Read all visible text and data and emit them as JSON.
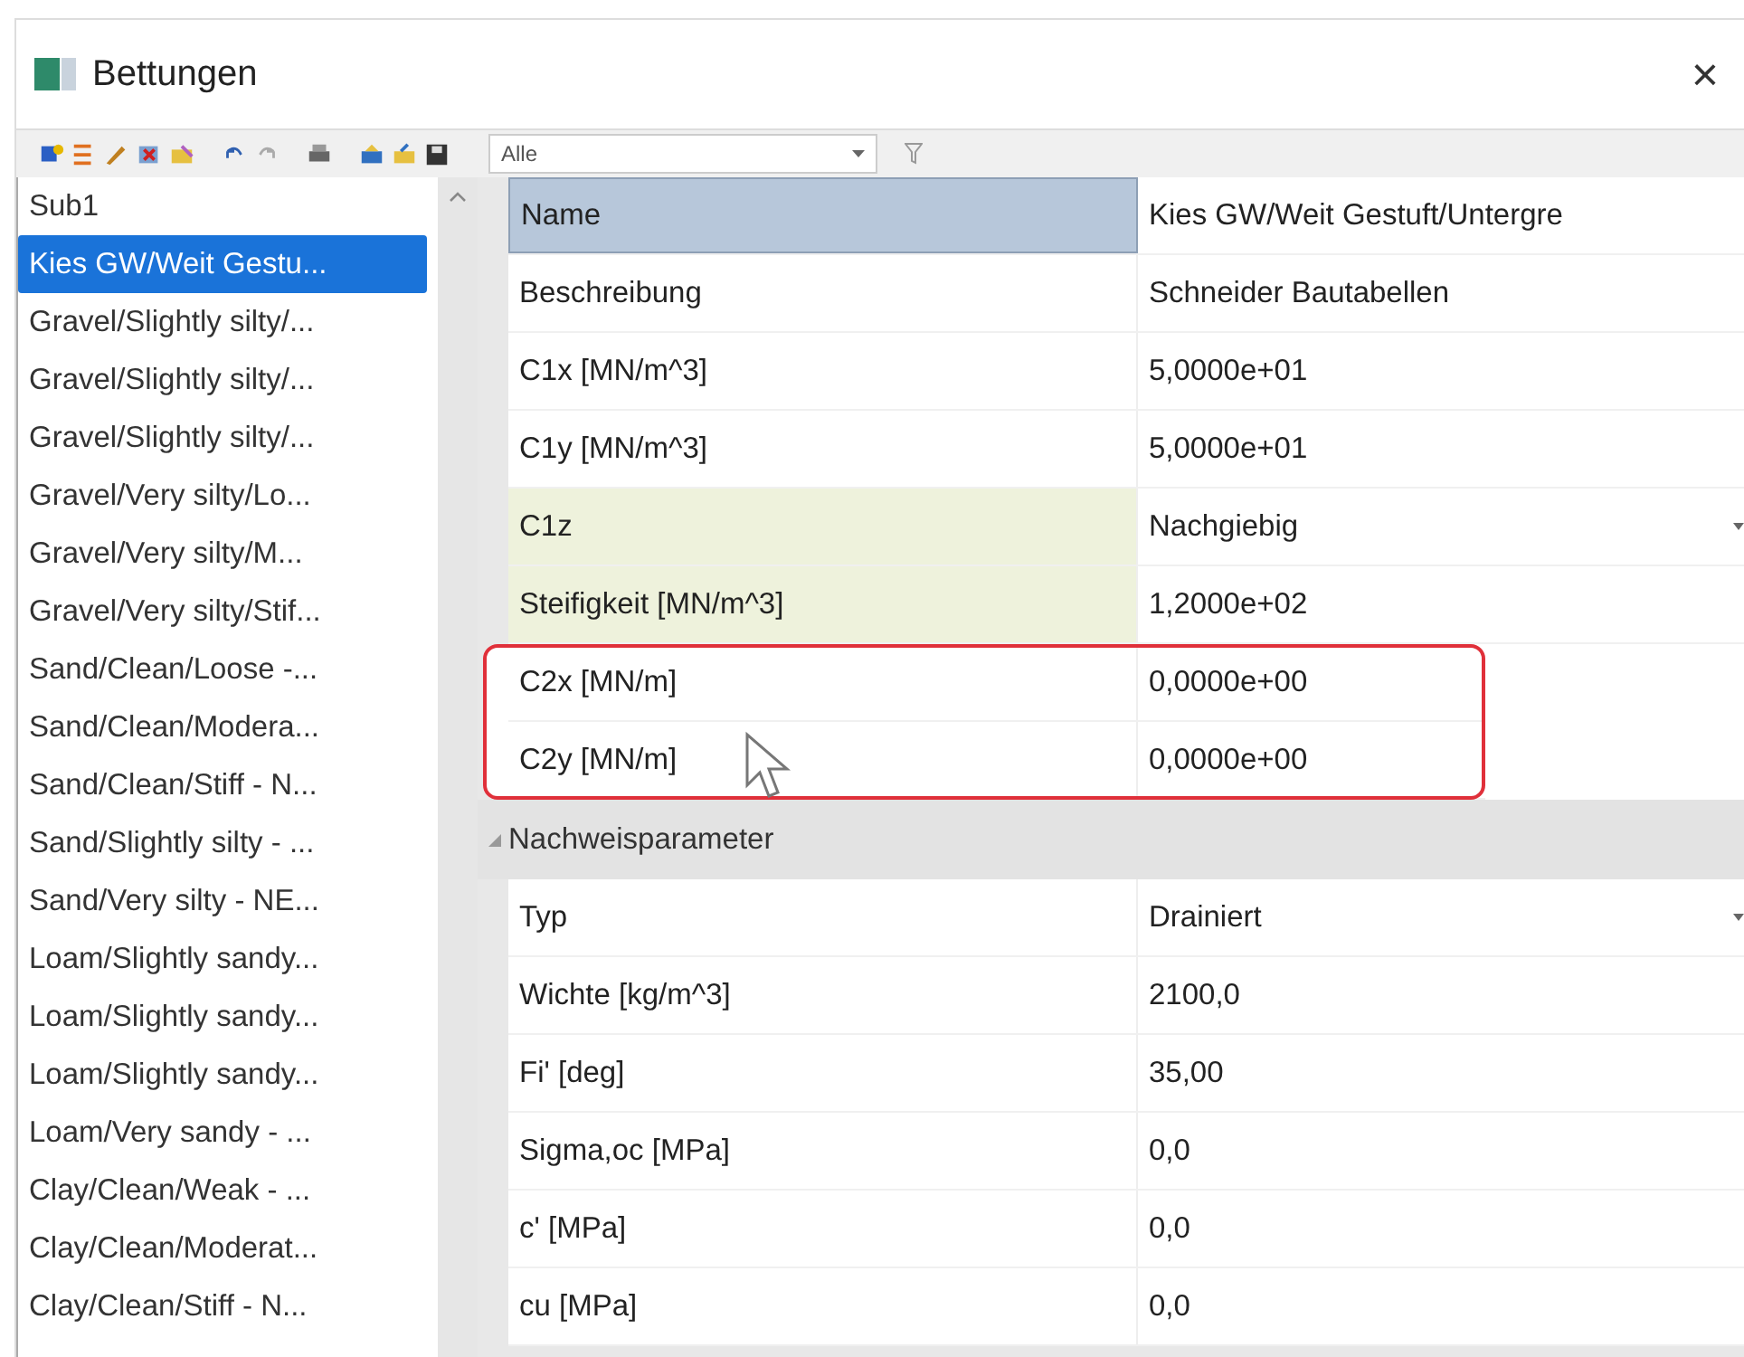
{
  "window": {
    "title": "Bettungen",
    "close": "×"
  },
  "toolbar": {
    "filter": {
      "value": "Alle"
    }
  },
  "list": {
    "items": [
      {
        "label": "Sub1",
        "selected": false
      },
      {
        "label": "Kies GW/Weit Gestu...",
        "selected": true
      },
      {
        "label": "Gravel/Slightly silty/...",
        "selected": false
      },
      {
        "label": "Gravel/Slightly silty/...",
        "selected": false
      },
      {
        "label": "Gravel/Slightly silty/...",
        "selected": false
      },
      {
        "label": "Gravel/Very silty/Lo...",
        "selected": false
      },
      {
        "label": "Gravel/Very silty/M...",
        "selected": false
      },
      {
        "label": "Gravel/Very silty/Stif...",
        "selected": false
      },
      {
        "label": "Sand/Clean/Loose -...",
        "selected": false
      },
      {
        "label": "Sand/Clean/Modera...",
        "selected": false
      },
      {
        "label": "Sand/Clean/Stiff - N...",
        "selected": false
      },
      {
        "label": "Sand/Slightly silty - ...",
        "selected": false
      },
      {
        "label": "Sand/Very silty - NE...",
        "selected": false
      },
      {
        "label": "Loam/Slightly sandy...",
        "selected": false
      },
      {
        "label": "Loam/Slightly sandy...",
        "selected": false
      },
      {
        "label": "Loam/Slightly sandy...",
        "selected": false
      },
      {
        "label": "Loam/Very sandy - ...",
        "selected": false
      },
      {
        "label": "Clay/Clean/Weak - ...",
        "selected": false
      },
      {
        "label": "Clay/Clean/Moderat...",
        "selected": false
      },
      {
        "label": "Clay/Clean/Stiff - N...",
        "selected": false
      }
    ]
  },
  "properties": {
    "groups": [
      {
        "rows": [
          {
            "label": "Name",
            "value": "Kies GW/Weit Gestuft/Untergre",
            "selected": true,
            "tinted": false,
            "dropdown": false,
            "circled": false
          },
          {
            "label": "Beschreibung",
            "value": "Schneider Bautabellen",
            "selected": false,
            "tinted": false,
            "dropdown": false,
            "circled": false
          },
          {
            "label": "C1x [MN/m^3]",
            "value": "5,0000e+01",
            "selected": false,
            "tinted": false,
            "dropdown": false,
            "circled": false
          },
          {
            "label": "C1y [MN/m^3]",
            "value": "5,0000e+01",
            "selected": false,
            "tinted": false,
            "dropdown": false,
            "circled": false
          },
          {
            "label": "C1z",
            "value": "Nachgiebig",
            "selected": false,
            "tinted": true,
            "dropdown": true,
            "circled": false
          },
          {
            "label": "Steifigkeit [MN/m^3]",
            "value": "1,2000e+02",
            "selected": false,
            "tinted": true,
            "dropdown": false,
            "circled": false
          },
          {
            "label": "C2x [MN/m]",
            "value": "0,0000e+00",
            "selected": false,
            "tinted": false,
            "dropdown": false,
            "circled": true
          },
          {
            "label": "C2y [MN/m]",
            "value": "0,0000e+00",
            "selected": false,
            "tinted": false,
            "dropdown": false,
            "circled": true
          }
        ]
      },
      {
        "title": "Nachweisparameter",
        "expanded": true,
        "rows": [
          {
            "label": "Typ",
            "value": "Drainiert",
            "selected": false,
            "tinted": false,
            "dropdown": true,
            "circled": false
          },
          {
            "label": "Wichte [kg/m^3]",
            "value": "2100,0",
            "selected": false,
            "tinted": false,
            "dropdown": false,
            "circled": false
          },
          {
            "label": "Fi' [deg]",
            "value": "35,00",
            "selected": false,
            "tinted": false,
            "dropdown": false,
            "circled": false
          },
          {
            "label": "Sigma,oc [MPa]",
            "value": "0,0",
            "selected": false,
            "tinted": false,
            "dropdown": false,
            "circled": false
          },
          {
            "label": "c' [MPa]",
            "value": "0,0",
            "selected": false,
            "tinted": false,
            "dropdown": false,
            "circled": false
          },
          {
            "label": "cu [MPa]",
            "value": "0,0",
            "selected": false,
            "tinted": false,
            "dropdown": false,
            "circled": false
          }
        ]
      }
    ]
  }
}
